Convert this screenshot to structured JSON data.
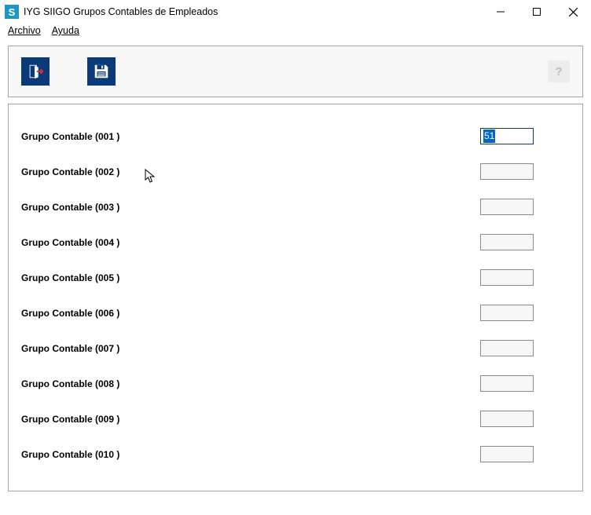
{
  "window": {
    "icon_letter": "S",
    "title": "IYG SIIGO Grupos Contables de Empleados"
  },
  "menu": {
    "archivo": "Archivo",
    "ayuda": "Ayuda"
  },
  "toolbar": {
    "help_label": "?"
  },
  "form": {
    "rows": [
      {
        "label": "Grupo Contable (001 )",
        "value": "51",
        "active": true
      },
      {
        "label": "Grupo Contable (002 )",
        "value": "",
        "active": false
      },
      {
        "label": "Grupo Contable (003 )",
        "value": "",
        "active": false
      },
      {
        "label": "Grupo Contable (004 )",
        "value": "",
        "active": false
      },
      {
        "label": "Grupo Contable (005 )",
        "value": "",
        "active": false
      },
      {
        "label": "Grupo Contable (006 )",
        "value": "",
        "active": false
      },
      {
        "label": "Grupo Contable (007 )",
        "value": "",
        "active": false
      },
      {
        "label": "Grupo Contable (008 )",
        "value": "",
        "active": false
      },
      {
        "label": "Grupo Contable (009 )",
        "value": "",
        "active": false
      },
      {
        "label": "Grupo Contable (010 )",
        "value": "",
        "active": false
      }
    ]
  }
}
